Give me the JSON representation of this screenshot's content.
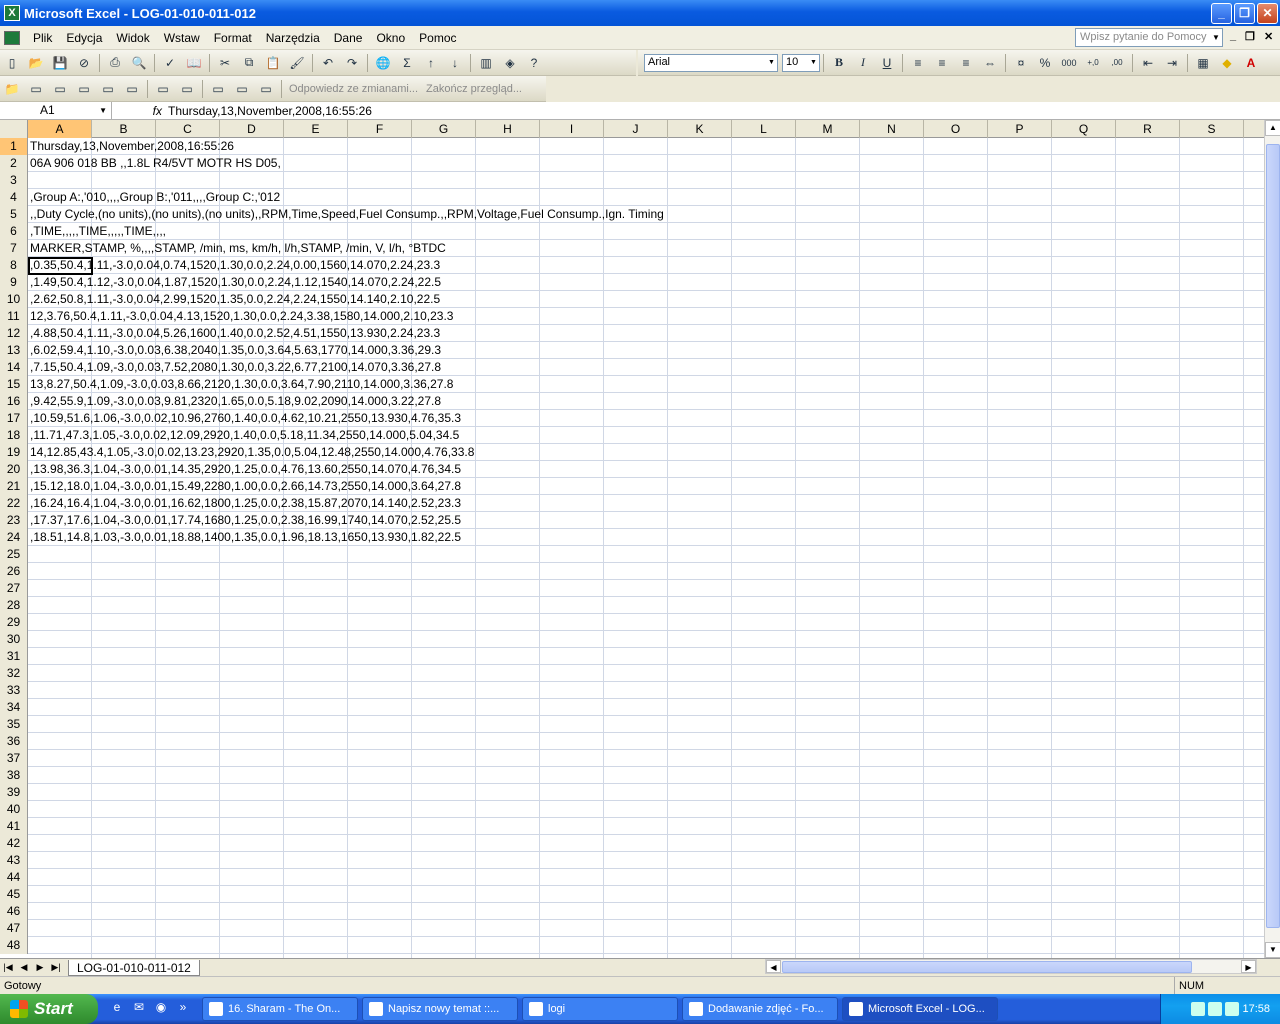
{
  "window": {
    "title": "Microsoft Excel - LOG-01-010-011-012",
    "app_icon": "X"
  },
  "menu": {
    "items": [
      "Plik",
      "Edycja",
      "Widok",
      "Wstaw",
      "Format",
      "Narzędzia",
      "Dane",
      "Okno",
      "Pomoc"
    ],
    "help_placeholder": "Wpisz pytanie do Pomocy"
  },
  "toolbar": {
    "font_name": "Arial",
    "font_size": "10",
    "review_reply": "Odpowiedz ze zmianami...",
    "review_end": "Zakończ przegląd..."
  },
  "formula": {
    "cell_ref": "A1",
    "fx": "fx",
    "content": "Thursday,13,November,2008,16:55:26"
  },
  "columns": [
    "A",
    "B",
    "C",
    "D",
    "E",
    "F",
    "G",
    "H",
    "I",
    "J",
    "K",
    "L",
    "M",
    "N",
    "O",
    "P",
    "Q",
    "R",
    "S"
  ],
  "row_numbers": [
    "1",
    "2",
    "3",
    "4",
    "5",
    "6",
    "7",
    "8",
    "9",
    "10",
    "11",
    "12",
    "13",
    "14",
    "15",
    "16",
    "17",
    "18",
    "19",
    "20",
    "21",
    "22",
    "23",
    "24",
    "25",
    "26",
    "27",
    "28",
    "29",
    "30",
    "31",
    "32",
    "33",
    "34",
    "35",
    "36",
    "37",
    "38",
    "39",
    "40",
    "41",
    "42",
    "43",
    "44",
    "45",
    "46",
    "47",
    "48"
  ],
  "cells": [
    "Thursday,13,November,2008,16:55:26",
    "06A 906 018 BB ,,1.8L R4/5VT MOTR HS D05,",
    "",
    ",Group A:,'010,,,,Group B:,'011,,,,Group C:,'012",
    ",,Duty Cycle,(no units),(no units),(no units),,RPM,Time,Speed,Fuel Consump.,,RPM,Voltage,Fuel Consump.,Ign. Timing",
    ",TIME,,,,,TIME,,,,,TIME,,,,",
    "MARKER,STAMP, %,,,,STAMP, /min, ms, km/h, l/h,STAMP, /min, V, l/h, °BTDC",
    ",0.35,50.4,1.11,-3.0,0.04,0.74,1520,1.30,0.0,2.24,0.00,1560,14.070,2.24,23.3",
    ",1.49,50.4,1.12,-3.0,0.04,1.87,1520,1.30,0.0,2.24,1.12,1540,14.070,2.24,22.5",
    ",2.62,50.8,1.11,-3.0,0.04,2.99,1520,1.35,0.0,2.24,2.24,1550,14.140,2.10,22.5",
    "12,3.76,50.4,1.11,-3.0,0.04,4.13,1520,1.30,0.0,2.24,3.38,1580,14.000,2.10,23.3",
    ",4.88,50.4,1.11,-3.0,0.04,5.26,1600,1.40,0.0,2.52,4.51,1550,13.930,2.24,23.3",
    ",6.02,59.4,1.10,-3.0,0.03,6.38,2040,1.35,0.0,3.64,5.63,1770,14.000,3.36,29.3",
    ",7.15,50.4,1.09,-3.0,0.03,7.52,2080,1.30,0.0,3.22,6.77,2100,14.070,3.36,27.8",
    "13,8.27,50.4,1.09,-3.0,0.03,8.66,2120,1.30,0.0,3.64,7.90,2110,14.000,3.36,27.8",
    ",9.42,55.9,1.09,-3.0,0.03,9.81,2320,1.65,0.0,5.18,9.02,2090,14.000,3.22,27.8",
    ",10.59,51.6,1.06,-3.0,0.02,10.96,2760,1.40,0.0,4.62,10.21,2550,13.930,4.76,35.3",
    ",11.71,47.3,1.05,-3.0,0.02,12.09,2920,1.40,0.0,5.18,11.34,2550,14.000,5.04,34.5",
    "14,12.85,43.4,1.05,-3.0,0.02,13.23,2920,1.35,0.0,5.04,12.48,2550,14.000,4.76,33.8",
    ",13.98,36.3,1.04,-3.0,0.01,14.35,2920,1.25,0.0,4.76,13.60,2550,14.070,4.76,34.5",
    ",15.12,18.0,1.04,-3.0,0.01,15.49,2280,1.00,0.0,2.66,14.73,2550,14.000,3.64,27.8",
    ",16.24,16.4,1.04,-3.0,0.01,16.62,1800,1.25,0.0,2.38,15.87,2070,14.140,2.52,23.3",
    ",17.37,17.6,1.04,-3.0,0.01,17.74,1680,1.25,0.0,2.38,16.99,1740,14.070,2.52,25.5",
    ",18.51,14.8,1.03,-3.0,0.01,18.88,1400,1.35,0.0,1.96,18.13,1650,13.930,1.82,22.5"
  ],
  "sheet_tab": "LOG-01-010-011-012",
  "status": {
    "text": "Gotowy",
    "num": "NUM"
  },
  "taskbar": {
    "start": "Start",
    "tasks": [
      "16. Sharam - The On...",
      "Napisz nowy temat ::...",
      "logi",
      "Dodawanie zdjęć - Fo...",
      "Microsoft Excel - LOG..."
    ],
    "clock": "17:58"
  }
}
